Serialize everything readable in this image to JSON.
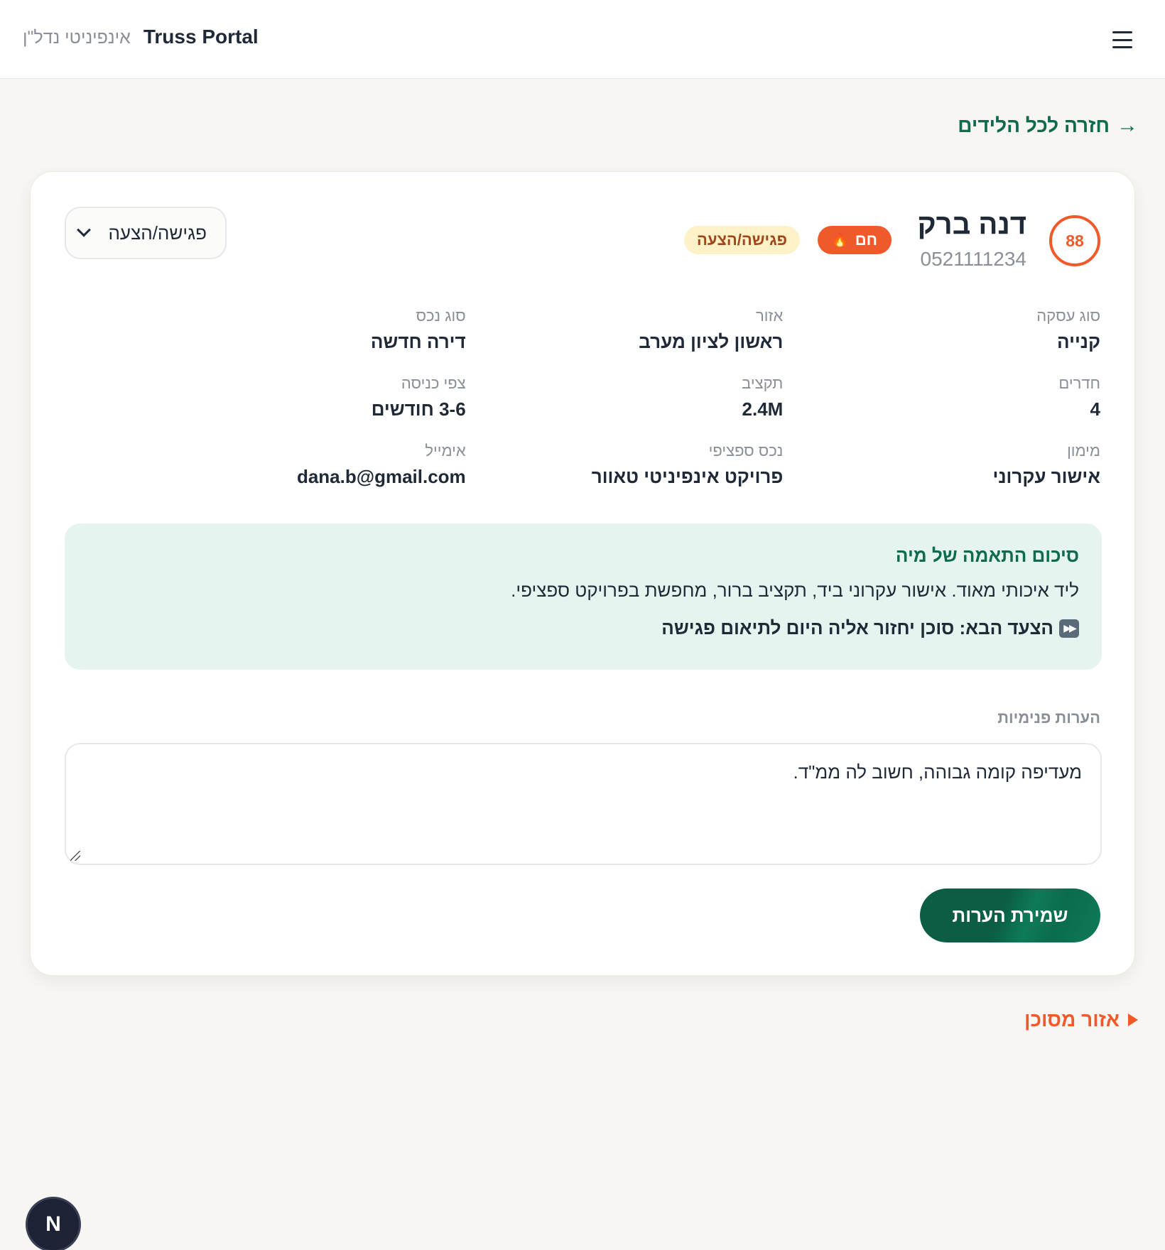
{
  "header": {
    "brand_title": "Truss Portal",
    "brand_subtitle": "אינפיניטי נדל\"ן",
    "menu_icon": "hamburger-icon"
  },
  "nav": {
    "back_label": "חזרה לכל הלידים",
    "back_icon": "arrow-right-icon"
  },
  "lead": {
    "score": "88",
    "name": "דנה ברק",
    "phone": "0521111234",
    "temperature_label": "חם",
    "temperature_icon": "flame-icon",
    "stage_badge": "פגישה/הצעה",
    "stage_select_value": "פגישה/הצעה",
    "fields": [
      {
        "label": "סוג עסקה",
        "value": "קנייה"
      },
      {
        "label": "אזור",
        "value": "ראשון לציון מערב"
      },
      {
        "label": "סוג נכס",
        "value": "דירה חדשה"
      },
      {
        "label": "חדרים",
        "value": "4"
      },
      {
        "label": "תקציב",
        "value": "2.4M"
      },
      {
        "label": "צפי כניסה",
        "value": "3-6 חודשים"
      },
      {
        "label": "מימון",
        "value": "אישור עקרוני"
      },
      {
        "label": "נכס ספציפי",
        "value": "פרויקט אינפיניטי טאוור"
      },
      {
        "label": "אימייל",
        "value": "dana.b@gmail.com"
      }
    ]
  },
  "summary": {
    "title": "סיכום התאמה של מיה",
    "text": "ליד איכותי מאוד. אישור עקרוני ביד, תקציב ברור, מחפשת בפרויקט ספציפי.",
    "next_step": "הצעד הבא: סוכן יחזור אליה היום לתיאום פגישה",
    "next_icon": "fast-forward-icon"
  },
  "notes": {
    "label": "הערות פנימיות",
    "value": "מעדיפה קומה גבוהה, חשוב לה ממ\"ד.",
    "save_label": "שמירת הערות"
  },
  "agent_zone": {
    "label": "אזור מסוכן"
  },
  "fab": {
    "label": "N"
  },
  "colors": {
    "accent_green": "#0f6b4f",
    "accent_orange": "#f05a2a",
    "stage_badge_bg": "#fdf1c8",
    "summary_bg": "#e6f4ef",
    "page_bg": "#f7f6f2"
  }
}
